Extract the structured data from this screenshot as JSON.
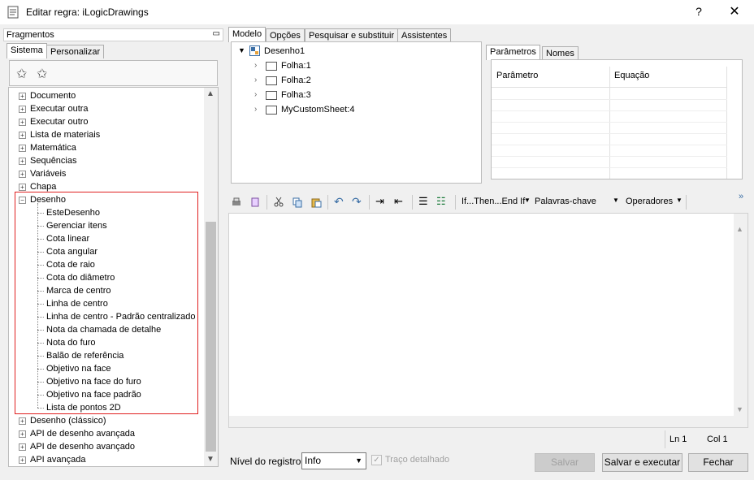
{
  "window": {
    "title": "Editar regra: iLogicDrawings",
    "help": "?",
    "close": "✕"
  },
  "left_panel": {
    "header": "Fragmentos",
    "pin": "📌",
    "tabs": [
      "Sistema",
      "Personalizar"
    ],
    "tree": [
      "Documento",
      "Executar outra",
      "Executar outro",
      "Lista de materiais",
      "Matemática",
      "Sequências",
      "Variáveis",
      "Chapa",
      "Desenho"
    ],
    "desenho_children": [
      "EsteDesenho",
      "Gerenciar itens",
      "Cota linear",
      "Cota angular",
      "Cota de raio",
      "Cota do diâmetro",
      "Marca de centro",
      "Linha de centro",
      "Linha de centro - Padrão centralizado",
      "Nota da chamada de detalhe",
      "Nota do furo",
      "Balão de referência",
      "Objetivo na face",
      "Objetivo na face do furo",
      "Objetivo na face padrão",
      "Lista de pontos 2D"
    ],
    "tree_after": [
      "Desenho (clássico)",
      "API de desenho avançada",
      "API de desenho avançado",
      "API avançada"
    ]
  },
  "top_tabs": [
    "Modelo",
    "Opções",
    "Pesquisar e substituir",
    "Assistentes"
  ],
  "model_tree": {
    "root": "Desenho1",
    "children": [
      "Folha:1",
      "Folha:2",
      "Folha:3",
      "MyCustomSheet:4"
    ]
  },
  "param_tabs": [
    "Parâmetros",
    "Nomes"
  ],
  "param_columns": [
    "Parâmetro",
    "Equação"
  ],
  "editor_toolbar": {
    "if_then": "If...Then...End If",
    "keywords": "Palavras-chave",
    "operators": "Operadores",
    "more": "»"
  },
  "status": {
    "line": "Ln 1",
    "col": "Col 1"
  },
  "bottom": {
    "log_label": "Nível do registro",
    "log_value": "Info",
    "verbose_label": "Traço detalhado",
    "save": "Salvar",
    "save_run": "Salvar e executar",
    "close": "Fechar"
  }
}
